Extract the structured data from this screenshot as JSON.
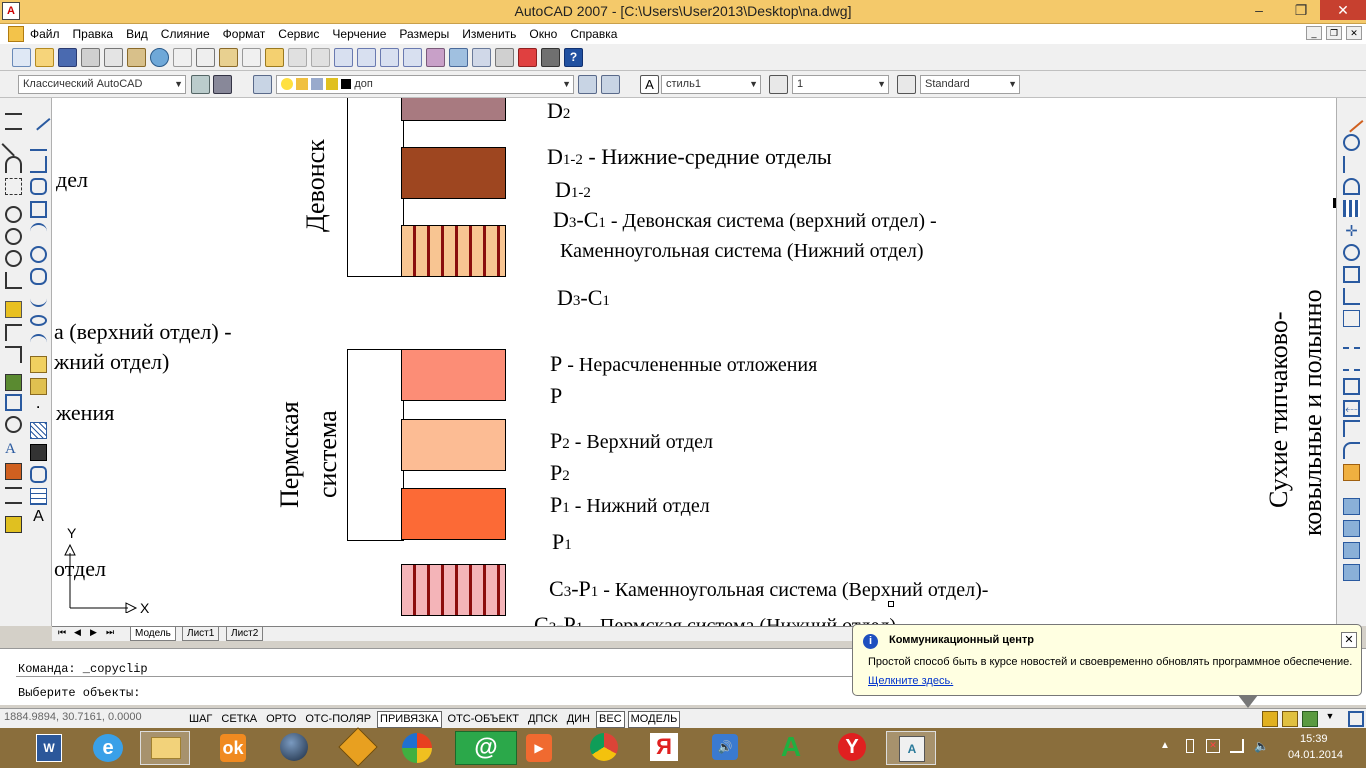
{
  "window": {
    "title": "AutoCAD 2007 - [C:\\Users\\User2013\\Desktop\\na.dwg]",
    "minimize": "–",
    "maximize": "❐",
    "close": "✕"
  },
  "menubar": {
    "items": [
      "Файл",
      "Правка",
      "Вид",
      "Слияние",
      "Формат",
      "Сервис",
      "Черчение",
      "Размеры",
      "Изменить",
      "Окно",
      "Справка"
    ]
  },
  "toolbar2": {
    "workspace": "Классический AutoCAD",
    "layer": "доп",
    "text_style": "стиль1",
    "dim_scale": "1",
    "table_style": "Standard"
  },
  "drawing": {
    "left_fragments": [
      "дел",
      "а (верхний отдел) -",
      "жний отдел)",
      "жения",
      "отдел"
    ],
    "group_devon": "Девонск",
    "group_perm_1": "Пермская",
    "group_perm_2": "система",
    "right_vertical_1": "Сухие типчаково-",
    "right_vertical_2": "ковыльные и полынно",
    "legend": [
      {
        "main": "D",
        "sub": "2",
        "desc": ""
      },
      {
        "main": "D",
        "sub": "1-2",
        "desc": " - Нижние-средние отделы"
      },
      {
        "main": "D",
        "sub": "1-2",
        "desc": ""
      },
      {
        "main": "D",
        "sub": "3",
        "main2": "-C",
        "sub2": "1",
        "desc": " - Девонская система (верхний отдел) -"
      },
      {
        "desc": "Каменноугольная система (Нижний отдел)"
      },
      {
        "main": "D",
        "sub": "3",
        "main2": "-C",
        "sub2": "1",
        "desc": ""
      },
      {
        "main": "P",
        "desc": " - Нерасчлененные отложения"
      },
      {
        "main": "P",
        "desc": ""
      },
      {
        "main": "P",
        "sub": "2",
        "desc": " - Верхний отдел"
      },
      {
        "main": "P",
        "sub": "2",
        "desc": ""
      },
      {
        "main": "P",
        "sub": "1",
        "desc": " - Нижний отдел"
      },
      {
        "main": "P",
        "sub": "1",
        "desc": ""
      },
      {
        "main": "C",
        "sub": "3",
        "main2": "-P",
        "sub2": "1",
        "desc": " - Каменноугольная система (Верхний отдел)-"
      },
      {
        "main": "C",
        "sub": "3",
        "main2": "-P",
        "sub2": "1",
        "desc": " - Пермская система (Нижний отдел)"
      }
    ],
    "swatch_colors": [
      "#a87a80",
      "#9e4620",
      "#f8c592",
      "#fc8d76",
      "#fcbc94",
      "#fc6a36",
      "#f4b4b8"
    ],
    "stripe_color": "#8b0d0d",
    "ucs_x": "X",
    "ucs_y": "Y"
  },
  "tabs": {
    "nav": [
      "⏮",
      "◀",
      "▶",
      "⏭"
    ],
    "model": "Модель",
    "sheet1": "Лист1",
    "sheet2": "Лист2"
  },
  "command": {
    "line1": "Команда: _copyclip",
    "line2": "Выберите объекты:"
  },
  "status": {
    "coords": "1884.9894, 30.7161, 0.0000",
    "toggles": [
      {
        "label": "ШАГ",
        "on": false
      },
      {
        "label": "СЕТКА",
        "on": false
      },
      {
        "label": "ОРТО",
        "on": false
      },
      {
        "label": "ОТС-ПОЛЯР",
        "on": false
      },
      {
        "label": "ПРИВЯЗКА",
        "on": true
      },
      {
        "label": "ОТС-ОБЪЕКТ",
        "on": false
      },
      {
        "label": "ДПСК",
        "on": false
      },
      {
        "label": "ДИН",
        "on": false
      },
      {
        "label": "ВЕС",
        "on": true
      },
      {
        "label": "МОДЕЛЬ",
        "on": true
      }
    ]
  },
  "balloon": {
    "title": "Коммуникационный центр",
    "message": "Простой способ быть в курсе новостей и своевременно обновлять программное обеспечение.",
    "link": "Щелкните здесь.",
    "close": "✕"
  },
  "taskbar": {
    "apps": [
      "word-icon",
      "ie-icon",
      "explorer-icon",
      "odnoklassniki-icon",
      "browser-globe-icon",
      "media-cross-icon",
      "messenger-ball-icon",
      "mail-at-icon",
      "video-player-icon",
      "chrome-icon",
      "yandex-y-icon",
      "volume-icon",
      "green-a-icon",
      "yandex-browser-icon",
      "autocad-icon"
    ],
    "time": "15:39",
    "date": "04.01.2014"
  }
}
